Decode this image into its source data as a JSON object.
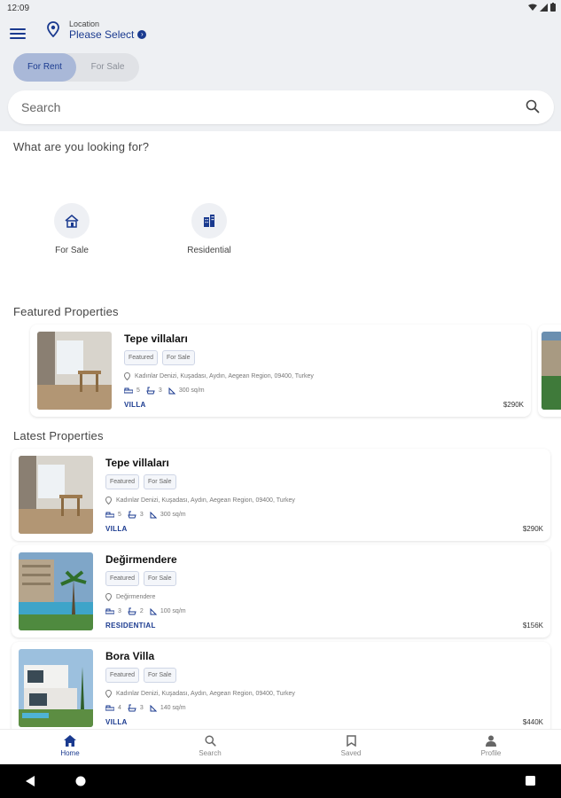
{
  "status": {
    "time": "12:09"
  },
  "header": {
    "location_caption": "Location",
    "location_value": "Please Select",
    "toggle": {
      "rent": "For Rent",
      "sale": "For Sale",
      "active": "rent"
    }
  },
  "search": {
    "placeholder": "Search"
  },
  "categories": {
    "title": "What are you looking for?",
    "items": [
      {
        "label": "For Sale",
        "icon": "house-icon"
      },
      {
        "label": "Residential",
        "icon": "building-icon"
      }
    ]
  },
  "featured": {
    "title": "Featured Properties",
    "items": [
      {
        "title": "Tepe villaları",
        "badges": [
          "Featured",
          "For Sale"
        ],
        "address": "Kadınlar Denizi, Kuşadası, Aydın, Aegean Region, 09400, Turkey",
        "beds": "5",
        "baths": "3",
        "area": "300 sq/m",
        "type": "VILLA",
        "price": "$290K"
      }
    ]
  },
  "latest": {
    "title": "Latest Properties",
    "items": [
      {
        "title": "Tepe villaları",
        "badges": [
          "Featured",
          "For Sale"
        ],
        "address": "Kadınlar Denizi, Kuşadası, Aydın, Aegean Region, 09400, Turkey",
        "beds": "5",
        "baths": "3",
        "area": "300 sq/m",
        "type": "VILLA",
        "price": "$290K"
      },
      {
        "title": "Değirmendere",
        "badges": [
          "Featured",
          "For Sale"
        ],
        "address": "Değirmendere",
        "beds": "3",
        "baths": "2",
        "area": "100 sq/m",
        "type": "RESIDENTIAL",
        "price": "$156K"
      },
      {
        "title": "Bora Villa",
        "badges": [
          "Featured",
          "For Sale"
        ],
        "address": "Kadınlar Denizi, Kuşadası, Aydın, Aegean Region, 09400, Turkey",
        "beds": "4",
        "baths": "3",
        "area": "140 sq/m",
        "type": "VILLA",
        "price": "$440K"
      }
    ]
  },
  "nav": {
    "home": "Home",
    "search": "Search",
    "saved": "Saved",
    "profile": "Profile",
    "active": "home"
  },
  "colors": {
    "primary": "#1a3a8f",
    "toggle_active": "#a9b8d8",
    "header_bg": "#eef0f3"
  }
}
